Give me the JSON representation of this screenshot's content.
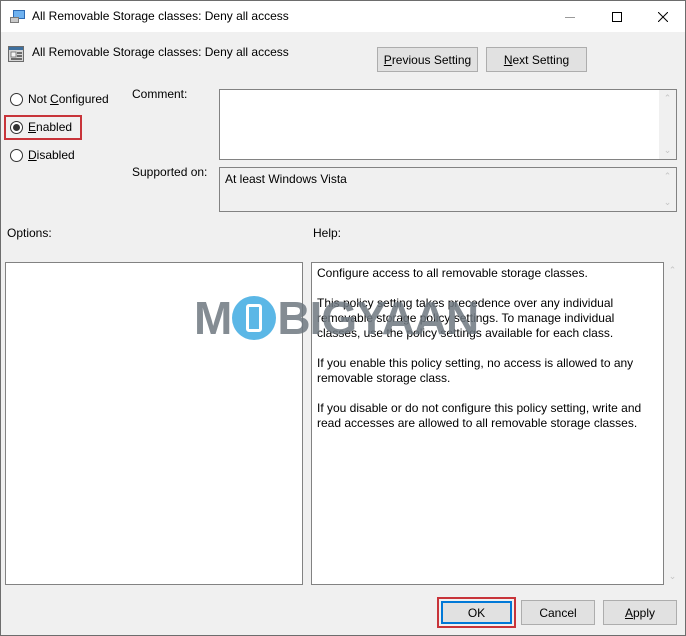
{
  "window": {
    "title": "All Removable Storage classes: Deny all access",
    "controls": {
      "minimize": "minimize-icon",
      "maximize": "maximize-icon",
      "close": "close-icon"
    }
  },
  "header": {
    "policy_title": "All Removable Storage classes: Deny all access",
    "previous_setting_label_accel": "P",
    "previous_setting_label_rest": "revious Setting",
    "next_setting_label_accel": "N",
    "next_setting_label_rest": "ext Setting"
  },
  "state_options": [
    {
      "pre": "Not ",
      "accel": "C",
      "post": "onfigured",
      "selected": false
    },
    {
      "pre": "",
      "accel": "E",
      "post": "nabled",
      "selected": true
    },
    {
      "pre": "",
      "accel": "D",
      "post": "isabled",
      "selected": false
    }
  ],
  "comment": {
    "label": "Comment:",
    "value": ""
  },
  "supported_on": {
    "label": "Supported on:",
    "value": "At least Windows Vista"
  },
  "options": {
    "label": "Options:"
  },
  "help": {
    "label": "Help:",
    "paragraphs": [
      "Configure access to all removable storage classes.",
      "This policy setting takes precedence over any individual removable storage policy settings. To manage individual classes, use the policy settings available for each class.",
      "If you enable this policy setting, no access is allowed to any removable storage class.",
      "If you disable or do not configure this policy setting, write and read accesses are allowed to all removable storage classes."
    ]
  },
  "footer": {
    "ok_label": "OK",
    "cancel_label": "Cancel",
    "apply_label_accel": "A",
    "apply_label_rest": "pply"
  },
  "highlight_color": "#c8343a",
  "watermark": {
    "left": "M",
    "right": "BIGYAAN"
  }
}
